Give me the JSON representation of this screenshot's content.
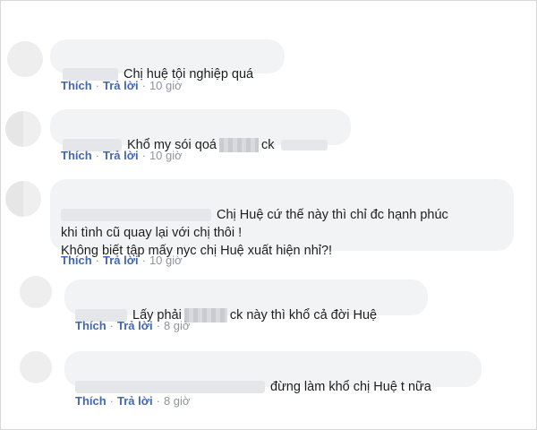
{
  "actions": {
    "like_label": "Thích",
    "reply_label": "Trả lời",
    "separator": "·"
  },
  "comments": [
    {
      "text": "Chị huệ tội nghiệp quá",
      "time": "10 giờ"
    },
    {
      "text_before": "Khổ my sói qoá",
      "text_after": "ck",
      "time": "10 giờ"
    },
    {
      "text": "Chị Huệ cứ thế này thì chỉ đc hạnh phúc\nkhi tình cũ quay lại với chị thôi !\nKhông biết tập mấy nyc chị Huệ xuất hiện nhỉ?!",
      "time": "10 giờ"
    },
    {
      "text_before": "Lấy phải",
      "text_after": "ck này thì khổ cả đời Huệ",
      "time": "8 giờ"
    },
    {
      "text": "đừng làm khổ chị Huệ t nữa",
      "time": "8 giờ"
    }
  ]
}
